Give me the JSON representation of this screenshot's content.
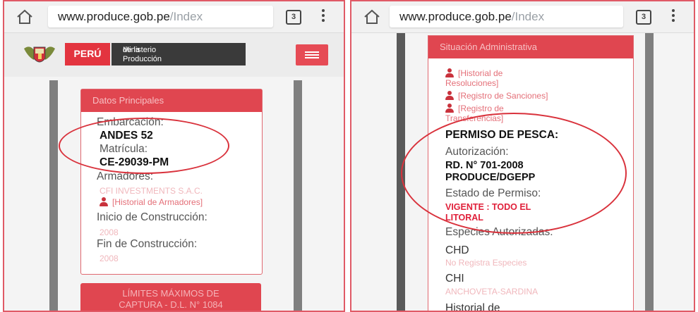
{
  "left": {
    "browser": {
      "domain": "www.produce.gob.pe",
      "path": "/Index",
      "tab_count": "3"
    },
    "header": {
      "peru": "PERÚ",
      "ministerio_line1": "Ministerio",
      "ministerio_line2": "de la Producción"
    },
    "card_title": "Datos Principales",
    "embarcacion_label": "Embarcación:",
    "embarcacion_value": "ANDES 52",
    "matricula_label": "Matrícula:",
    "matricula_value": "CE-29039-PM",
    "armadores_label": "Armadores:",
    "armadores_value": "CFI INVESTMENTS S.A.C.",
    "armadores_link": "[Historial de Armadores]",
    "inicio_label": "Inicio de Construcción:",
    "inicio_value": "2008",
    "fin_label": "Fin de Construcción:",
    "fin_value": "2008",
    "bottom_card_line1": "LÍMITES MÁXIMOS DE",
    "bottom_card_line2": "CAPTURA - D.L. N° 1084"
  },
  "right": {
    "browser": {
      "domain": "www.produce.gob.pe",
      "path": "/Index",
      "tab_count": "3"
    },
    "card_title": "Situación Administrativa",
    "link_resoluciones_1": "[Historial de",
    "link_resoluciones_2": "Resoluciones]",
    "link_sanciones": "[Registro de Sanciones]",
    "link_transferencias_1": "[Registro de",
    "link_transferencias_2": "Transferencias]",
    "permiso_heading": "PERMISO DE PESCA:",
    "autorizacion_label": "Autorización:",
    "autorizacion_value_1": "RD. N° 701-2008",
    "autorizacion_value_2": "PRODUCE/DGEPP",
    "estado_label": "Estado de Permiso:",
    "estado_value_1": "VIGENTE : TODO EL",
    "estado_value_2": "LITORAL",
    "especies_label": "Especies Autorizadas:",
    "chd_label": "CHD",
    "chd_value": "No Registra Especies",
    "chi_label": "CHI",
    "chi_value": "ANCHOVETA-SARDINA",
    "historial_label": "Historial de"
  },
  "colors": {
    "accent": "#e04650",
    "circle": "#d9323c",
    "value_red": "#e0203a"
  }
}
